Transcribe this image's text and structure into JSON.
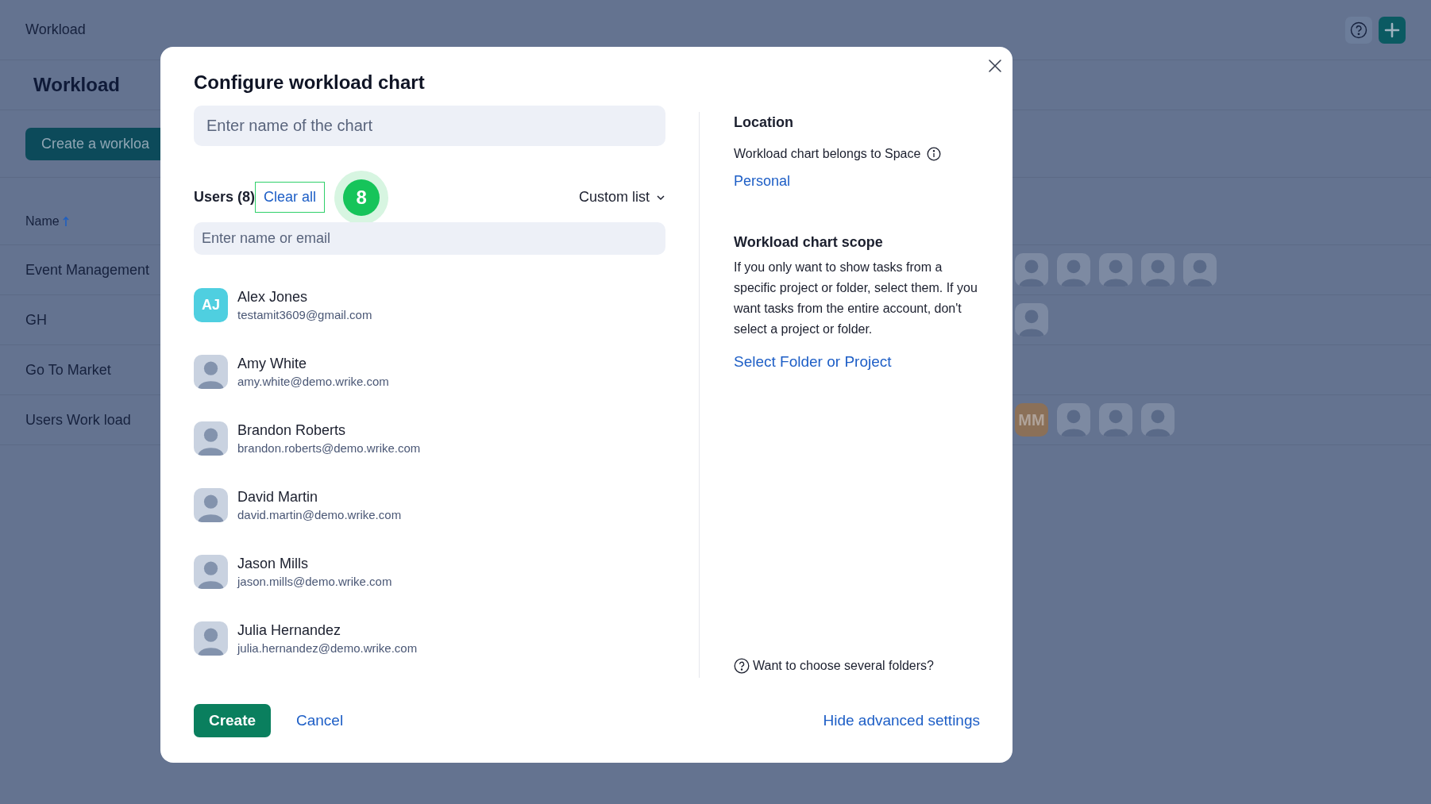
{
  "app": {
    "title": "Workload",
    "heading": "Workload",
    "create_button": "Create a workloa",
    "column_header": "Name",
    "rows": [
      {
        "name": "Event Management",
        "avatars": [
          {
            "kind": "photo"
          },
          {
            "kind": "photo"
          },
          {
            "kind": "photo"
          },
          {
            "kind": "photo"
          },
          {
            "kind": "photo"
          }
        ]
      },
      {
        "name": "GH",
        "avatars": [
          {
            "kind": "photo"
          }
        ]
      },
      {
        "name": "Go To Market"
      },
      {
        "name": "Users Work load",
        "avatars": [
          {
            "kind": "initials",
            "initials": "MM",
            "color": "#8b7058"
          },
          {
            "kind": "photo"
          },
          {
            "kind": "photo"
          },
          {
            "kind": "photo"
          }
        ]
      }
    ]
  },
  "dialog": {
    "title": "Configure workload chart",
    "name_field": {
      "placeholder": "Enter name of the chart"
    },
    "users_label": "Users (8)",
    "clear_button": "Clear all",
    "step_marker": "8",
    "list_mode": "Custom list",
    "user_search": {
      "placeholder": "Enter name or email"
    },
    "users": [
      {
        "name": "Alex Jones",
        "email": "testamit3609@gmail.com",
        "avatar": {
          "kind": "initials",
          "initials": "AJ",
          "color": "#4fcfe0"
        }
      },
      {
        "name": "Amy White",
        "email": "amy.white@demo.wrike.com",
        "avatar": {
          "kind": "photo"
        }
      },
      {
        "name": "Brandon Roberts",
        "email": "brandon.roberts@demo.wrike.com",
        "avatar": {
          "kind": "photo"
        }
      },
      {
        "name": "David Martin",
        "email": "david.martin@demo.wrike.com",
        "avatar": {
          "kind": "photo"
        }
      },
      {
        "name": "Jason Mills",
        "email": "jason.mills@demo.wrike.com",
        "avatar": {
          "kind": "photo"
        }
      },
      {
        "name": "Julia Hernandez",
        "email": "julia.hernandez@demo.wrike.com",
        "avatar": {
          "kind": "photo"
        }
      }
    ],
    "location": {
      "heading": "Location",
      "text": "Workload chart belongs to Space",
      "link": "Personal"
    },
    "scope": {
      "heading": "Workload chart scope",
      "text": "If you only want to show tasks from a specific project or folder, select them. If you want tasks from the entire account, don't select a project or folder.",
      "link": "Select Folder or Project"
    },
    "help_link": "Want to choose several folders?",
    "create_button": "Create",
    "cancel_button": "Cancel",
    "advanced_link": "Hide advanced settings"
  }
}
